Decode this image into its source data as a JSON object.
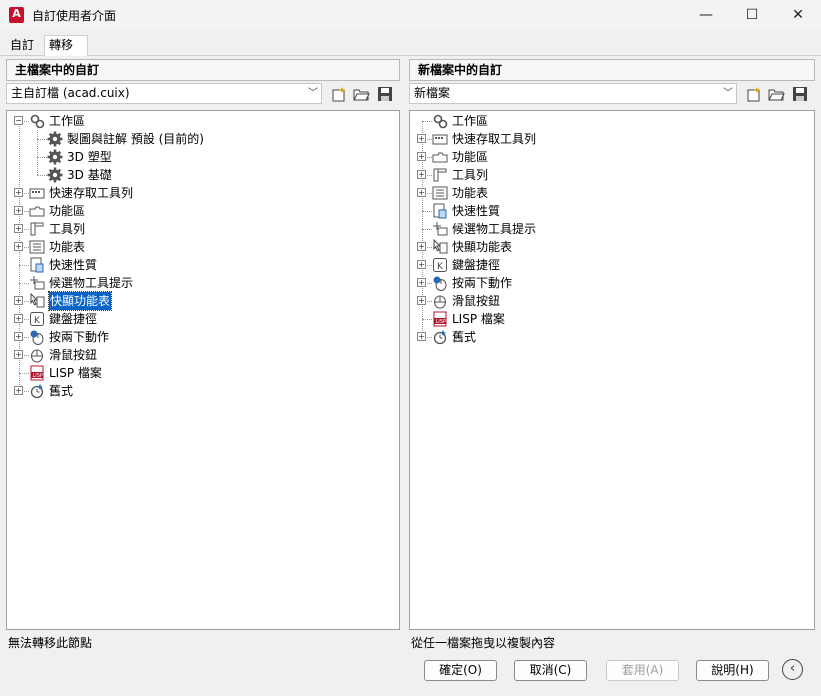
{
  "window": {
    "title": "自訂使用者介面",
    "minimize": "—",
    "maximize": "☐",
    "close": "✕",
    "app_icon_letter": "A"
  },
  "tabs": [
    {
      "label": "自訂"
    },
    {
      "label": "轉移"
    }
  ],
  "left": {
    "header": "主檔案中的自訂",
    "combo_value": "主自訂檔 (acad.cuix)",
    "status": "無法轉移此節點",
    "tree": [
      {
        "label": "工作區",
        "icon": "workspace-icon",
        "expander": "−"
      },
      {
        "label": "製圖與註解 預設 (目前的)",
        "icon": "gear-icon"
      },
      {
        "label": "3D 塑型",
        "icon": "gear-icon"
      },
      {
        "label": "3D 基礎",
        "icon": "gear-icon"
      },
      {
        "label": "快速存取工具列",
        "icon": "quick-access-toolbar-icon",
        "expander": "+"
      },
      {
        "label": "功能區",
        "icon": "ribbon-icon",
        "expander": "+"
      },
      {
        "label": "工具列",
        "icon": "toolbar-icon",
        "expander": "+"
      },
      {
        "label": "功能表",
        "icon": "menu-icon",
        "expander": "+"
      },
      {
        "label": "快速性質",
        "icon": "quick-properties-icon"
      },
      {
        "label": "候選物工具提示",
        "icon": "rollover-tooltip-icon"
      },
      {
        "label": "快顯功能表",
        "icon": "shortcut-menu-icon",
        "expander": "+"
      },
      {
        "label": "鍵盤捷徑",
        "icon": "keyboard-shortcut-icon",
        "expander": "+"
      },
      {
        "label": "按兩下動作",
        "icon": "double-click-icon",
        "expander": "+"
      },
      {
        "label": "滑鼠按鈕",
        "icon": "mouse-button-icon",
        "expander": "+"
      },
      {
        "label": "LISP 檔案",
        "icon": "lisp-file-icon"
      },
      {
        "label": "舊式",
        "icon": "legacy-icon",
        "expander": "+"
      }
    ]
  },
  "right": {
    "header": "新檔案中的自訂",
    "combo_value": "新檔案",
    "status": "從任一檔案拖曳以複製內容",
    "tree": [
      {
        "label": "工作區",
        "icon": "workspace-icon"
      },
      {
        "label": "快速存取工具列",
        "icon": "quick-access-toolbar-icon",
        "expander": "+"
      },
      {
        "label": "功能區",
        "icon": "ribbon-icon",
        "expander": "+"
      },
      {
        "label": "工具列",
        "icon": "toolbar-icon",
        "expander": "+"
      },
      {
        "label": "功能表",
        "icon": "menu-icon",
        "expander": "+"
      },
      {
        "label": "快速性質",
        "icon": "quick-properties-icon"
      },
      {
        "label": "候選物工具提示",
        "icon": "rollover-tooltip-icon"
      },
      {
        "label": "快顯功能表",
        "icon": "shortcut-menu-icon",
        "expander": "+"
      },
      {
        "label": "鍵盤捷徑",
        "icon": "keyboard-shortcut-icon",
        "expander": "+"
      },
      {
        "label": "按兩下動作",
        "icon": "double-click-icon",
        "expander": "+"
      },
      {
        "label": "滑鼠按鈕",
        "icon": "mouse-button-icon",
        "expander": "+"
      },
      {
        "label": "LISP 檔案",
        "icon": "lisp-file-icon"
      },
      {
        "label": "舊式",
        "icon": "legacy-icon",
        "expander": "+"
      }
    ]
  },
  "buttons": {
    "ok": "確定(O)",
    "cancel": "取消(C)",
    "apply": "套用(A)",
    "help": "說明(H)",
    "collapse": "‹"
  },
  "colors": {
    "selection": "#0a64c8",
    "lisp_red": "#b0142c"
  }
}
